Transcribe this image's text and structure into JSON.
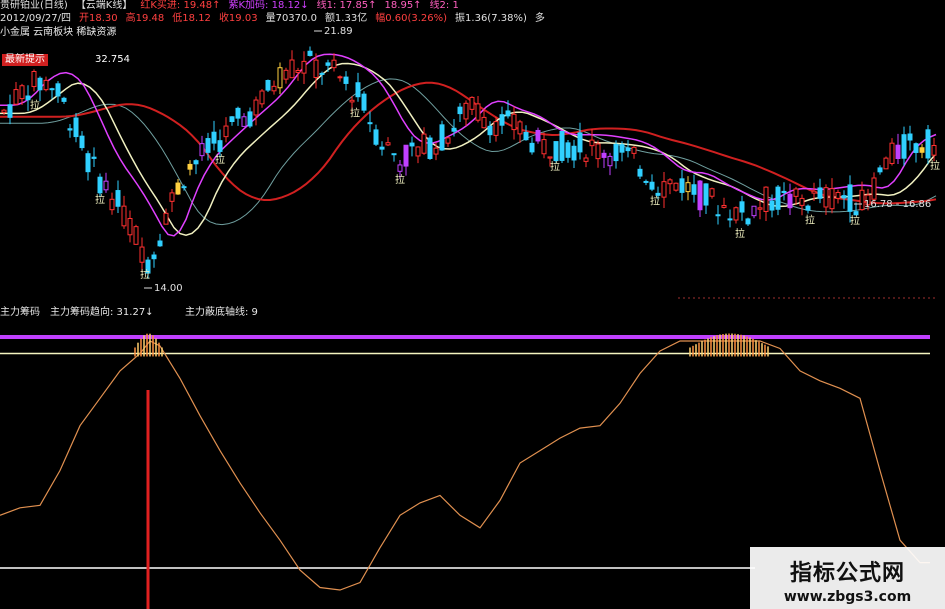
{
  "header": {
    "line1": [
      {
        "text": "贵研铂业(日线)",
        "color": "#e0e0e0"
      },
      {
        "text": "【云端K线】",
        "color": "#e0e0e0"
      },
      {
        "text": "红K买进: 19.48↑",
        "color": "#ff4040"
      },
      {
        "text": "紫K加码: 18.12↓",
        "color": "#d040ff"
      },
      {
        "text": "线1: 17.85↑",
        "color": "#ff60c0"
      },
      {
        "text": "18.95↑",
        "color": "#ff60c0"
      },
      {
        "text": "线2: 1",
        "color": "#ff60c0"
      }
    ],
    "line2": [
      {
        "text": "2012/09/27/四",
        "color": "#e0e0e0"
      },
      {
        "text": "开18.30",
        "color": "#ff4040"
      },
      {
        "text": "高19.48",
        "color": "#ff4040"
      },
      {
        "text": "低18.12",
        "color": "#ff4040"
      },
      {
        "text": "收19.03",
        "color": "#ff4040"
      },
      {
        "text": "量70370.0",
        "color": "#e0e0e0"
      },
      {
        "text": "额1.33亿",
        "color": "#e0e0e0"
      },
      {
        "text": "幅0.60(3.26%)",
        "color": "#ff4040"
      },
      {
        "text": "振1.36(7.38%)",
        "color": "#e0e0e0"
      },
      {
        "text": "多",
        "color": "#e0e0e0"
      }
    ],
    "line3": "小金属 云南板块 稀缺资源",
    "tag": "最新提示",
    "tag_value": "32.754"
  },
  "lower_header": {
    "name": "主力筹码",
    "trend_label": "主力筹码趋向: 31.27↓",
    "axis_label": "主力蔽底轴线: 9"
  },
  "watermark": {
    "title": "指标公式网",
    "url": "www.zbgs3.com"
  },
  "colors": {
    "up": "#ff3030",
    "down": "#30d0ff",
    "purple": "#c040ff",
    "yellow": "#ffd040",
    "ma_red": "#d02020",
    "ma_white": "#f0f0c0",
    "ma_magenta": "#e040ff",
    "ma_gray": "#70a0a0",
    "osc": "#e09050",
    "top_line": "#c040ff",
    "mid_line": "#f5f5c0",
    "bottom_line": "#ffffff"
  },
  "chart_data": [
    {
      "type": "candlestick",
      "title": "贵研铂业(日线)",
      "annotations": [
        {
          "label": "21.89",
          "x": 320
        },
        {
          "label": "14.00",
          "x": 150
        },
        {
          "label": "16.78 - 16.86",
          "x": 860
        }
      ],
      "markers": {
        "label": "拉",
        "x": [
          35,
          100,
          145,
          220,
          355,
          400,
          555,
          655,
          740,
          810,
          855,
          935
        ]
      },
      "price_range": [
        14.0,
        21.89
      ]
    },
    {
      "type": "line",
      "title": "主力筹码",
      "series": [
        {
          "name": "主力筹码趋向",
          "x": [
            0,
            20,
            40,
            60,
            80,
            100,
            120,
            140,
            150,
            160,
            180,
            200,
            220,
            240,
            260,
            280,
            300,
            320,
            340,
            360,
            380,
            400,
            420,
            440,
            460,
            480,
            500,
            520,
            540,
            560,
            580,
            600,
            620,
            640,
            660,
            680,
            700,
            720,
            740,
            760,
            780,
            800,
            820,
            840,
            860,
            880,
            900,
            920,
            930
          ],
          "values": [
            30,
            33,
            34,
            48,
            66,
            77,
            88,
            95,
            100,
            98,
            85,
            70,
            56,
            43,
            31,
            20,
            8,
            1,
            0,
            3,
            17,
            30,
            35,
            38,
            30,
            25,
            36,
            51,
            56,
            61,
            65,
            66,
            75,
            87,
            96,
            100,
            100,
            100,
            100,
            100,
            97,
            88,
            84,
            81,
            77,
            48,
            20,
            11,
            11
          ]
        }
      ],
      "reference_lines": {
        "top": 100,
        "mid": 97,
        "bottom": 0
      },
      "y_range": [
        0,
        100
      ]
    }
  ]
}
